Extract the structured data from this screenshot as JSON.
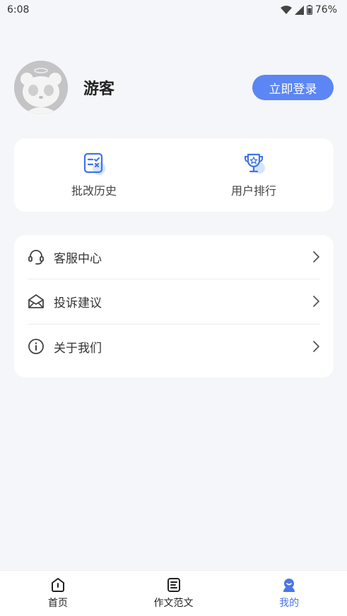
{
  "status_bar": {
    "time": "6:08",
    "battery": "76%"
  },
  "profile": {
    "username": "游客",
    "login_label": "立即登录"
  },
  "quick_actions": [
    {
      "label": "批改历史",
      "icon": "checklist-icon"
    },
    {
      "label": "用户排行",
      "icon": "trophy-icon"
    }
  ],
  "menu": [
    {
      "label": "客服中心",
      "icon": "headset-icon"
    },
    {
      "label": "投诉建议",
      "icon": "envelope-icon"
    },
    {
      "label": "关于我们",
      "icon": "info-icon"
    }
  ],
  "tabs": [
    {
      "label": "首页",
      "icon": "home-icon",
      "active": false
    },
    {
      "label": "作文范文",
      "icon": "document-icon",
      "active": false
    },
    {
      "label": "我的",
      "icon": "user-icon",
      "active": true
    }
  ],
  "colors": {
    "accent": "#5b86f4",
    "background": "#f5f6f9",
    "active_tab": "#4a76e8"
  }
}
